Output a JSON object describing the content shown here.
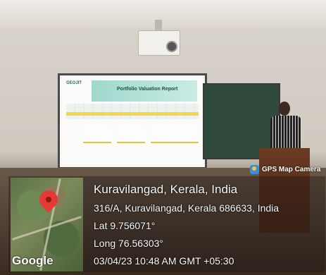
{
  "badge": {
    "label": "GPS Map Camera"
  },
  "map": {
    "logo_text": "Google"
  },
  "location": {
    "title": "Kuravilangad, Kerala, India",
    "address": "316/A, Kuravilangad, Kerala 686633, India",
    "latitude": "Lat 9.756071°",
    "longitude": "Long 76.56303°",
    "timestamp": "03/04/23 10:48 AM GMT +05:30"
  },
  "projected_slide": {
    "logo": "GEOJIT",
    "title": "Portfolio Valuation Report"
  },
  "colors": {
    "pin": "#e53935",
    "slide_accent": "#9fd8cc",
    "highlight": "#f4d64a",
    "chalkboard": "#2f4a3b"
  }
}
